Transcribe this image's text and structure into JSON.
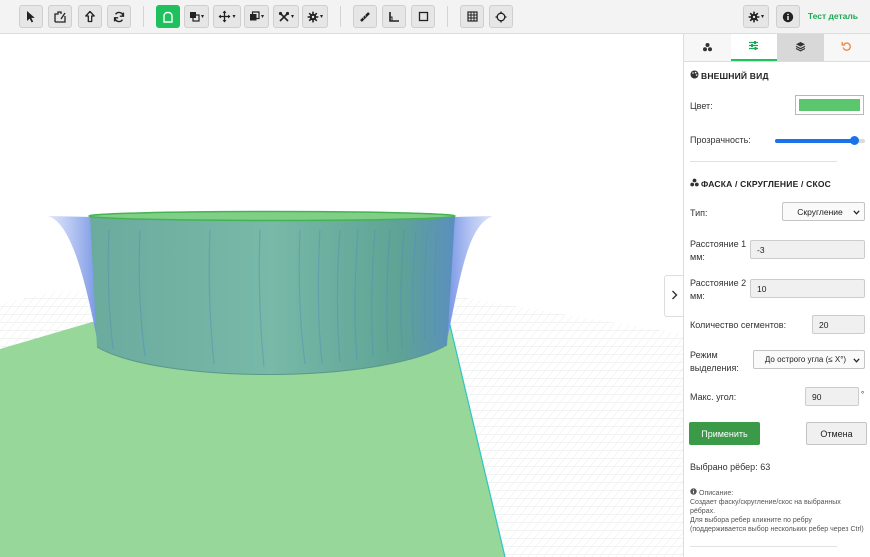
{
  "toolbar": {
    "title": "Тест деталь",
    "caret": "▾"
  },
  "panel": {
    "appearance": {
      "header": "ВНЕШНИЙ ВИД",
      "color_label": "Цвет:",
      "color_value": "#5bc66e",
      "opacity_label": "Прозрачность:",
      "opacity": 0.88
    },
    "chamfer": {
      "header": "ФАСКА / СКРУГЛЕНИЕ / СКОС",
      "type_label": "Тип:",
      "type_value": "Скругление",
      "dist1_label": "Расстояние 1 мм:",
      "dist1_value": "-3",
      "dist2_label": "Расстояние 2 мм:",
      "dist2_value": "10",
      "segments_label": "Количество сегментов:",
      "segments_value": "20",
      "mode_label": "Режим выделения:",
      "mode_value": "До острого угла (≤ X°)",
      "max_angle_label": "Макс. угол:",
      "max_angle_value": "90",
      "degree_mark": "°",
      "apply_label": "Применить",
      "cancel_label": "Отмена",
      "selected_edges": "Выбрано рёбер: 63",
      "desc_title": "Описание:",
      "desc_line1": "Создает фаску/скругление/скос на выбранных рёбрах.",
      "desc_line2": "Для выбора ребер кликните по ребру (поддерживается выбор нескольких ребер через Ctrl)"
    }
  },
  "colors": {
    "accent": "#1fc15e",
    "apply_button": "#3a9a47",
    "model_teal": "#6fb5a4",
    "flare_blue": "#8aa2e8",
    "ground_green": "#97d79a"
  }
}
